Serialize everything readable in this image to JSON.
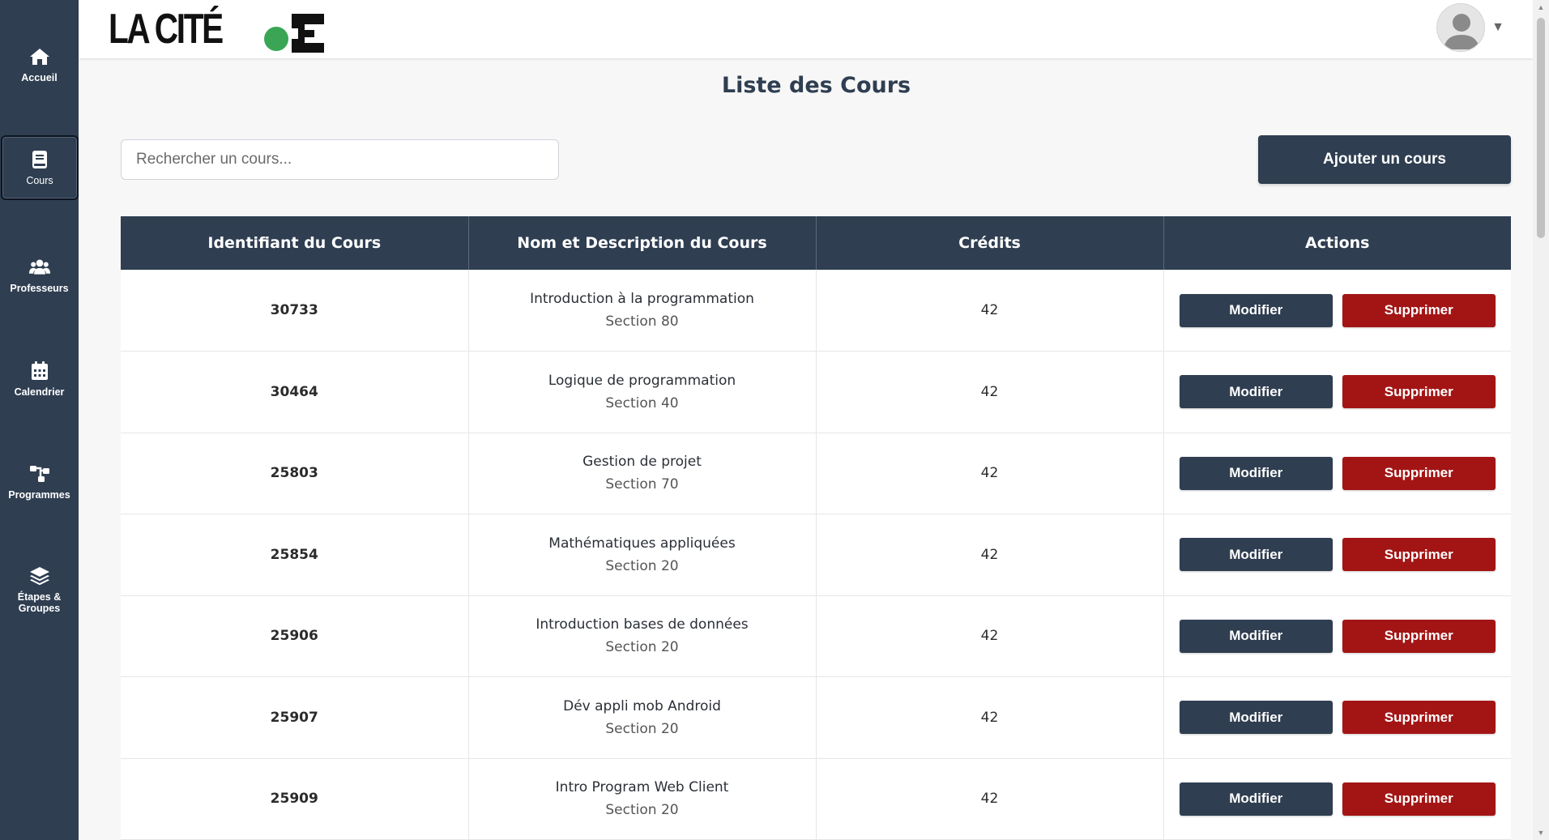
{
  "brand": {
    "logo_text": "LA CITÉ"
  },
  "sidebar": {
    "items": [
      {
        "label": "Accueil",
        "icon": "home-icon"
      },
      {
        "label": "Cours",
        "icon": "book-icon",
        "active": true
      },
      {
        "label": "Professeurs",
        "icon": "users-icon"
      },
      {
        "label": "Calendrier",
        "icon": "calendar-icon"
      },
      {
        "label": "Programmes",
        "icon": "sitemap-icon"
      },
      {
        "label_line1": "Étapes &",
        "label_line2": "Groupes",
        "icon": "layers-icon"
      }
    ]
  },
  "header": {
    "avatar_caret": "▼"
  },
  "main": {
    "title": "Liste des Cours",
    "search_placeholder": "Rechercher un cours...",
    "add_button": "Ajouter un cours",
    "table": {
      "headers": [
        "Identifiant du Cours",
        "Nom et Description du Cours",
        "Crédits",
        "Actions"
      ],
      "edit_label": "Modifier",
      "delete_label": "Supprimer",
      "rows": [
        {
          "id": "30733",
          "name": "Introduction à la programmation",
          "section": "Section 80",
          "credits": "42"
        },
        {
          "id": "30464",
          "name": "Logique de programmation",
          "section": "Section 40",
          "credits": "42"
        },
        {
          "id": "25803",
          "name": "Gestion de projet",
          "section": "Section 70",
          "credits": "42"
        },
        {
          "id": "25854",
          "name": "Mathématiques appliquées",
          "section": "Section 20",
          "credits": "42"
        },
        {
          "id": "25906",
          "name": "Introduction bases de données",
          "section": "Section 20",
          "credits": "42"
        },
        {
          "id": "25907",
          "name": "Dév appli mob Android",
          "section": "Section 20",
          "credits": "42"
        },
        {
          "id": "25909",
          "name": "Intro Program Web Client",
          "section": "Section 20",
          "credits": "42"
        }
      ]
    }
  },
  "colors": {
    "primary": "#2f3e51",
    "danger": "#a31515",
    "logo_green": "#3aa655"
  }
}
